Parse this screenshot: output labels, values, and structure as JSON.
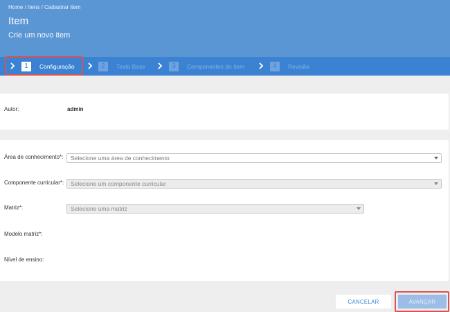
{
  "header": {
    "breadcrumb": "Home / Itens / Cadastrar item",
    "title": "Item",
    "subtitle": "Crie um novo item"
  },
  "steps": [
    {
      "number": "1",
      "label": "Configuração",
      "active": true
    },
    {
      "number": "2",
      "label": "Texto Base",
      "active": false
    },
    {
      "number": "3",
      "label": "Componentes do item",
      "active": false
    },
    {
      "number": "4",
      "label": "Revisão",
      "active": false
    }
  ],
  "author": {
    "label": "Autor:",
    "value": "admin"
  },
  "form": {
    "area": {
      "label": "Área de conhecimento*:",
      "placeholder": "Selecione uma área de conhecimento"
    },
    "componente": {
      "label": "Componente curricular*:",
      "placeholder": "Selecione um componente curricular"
    },
    "matriz": {
      "label": "Matriz*:",
      "placeholder": "Selecione uma matriz"
    },
    "modelo": {
      "label": "Modelo matriz*:"
    },
    "nivel": {
      "label": "Nível de ensino:"
    }
  },
  "buttons": {
    "cancel": "CANCELAR",
    "next": "AVANÇAR"
  },
  "colors": {
    "header": "#5b96d4",
    "stepbar": "#3b82d3",
    "highlight": "#d9534f"
  }
}
